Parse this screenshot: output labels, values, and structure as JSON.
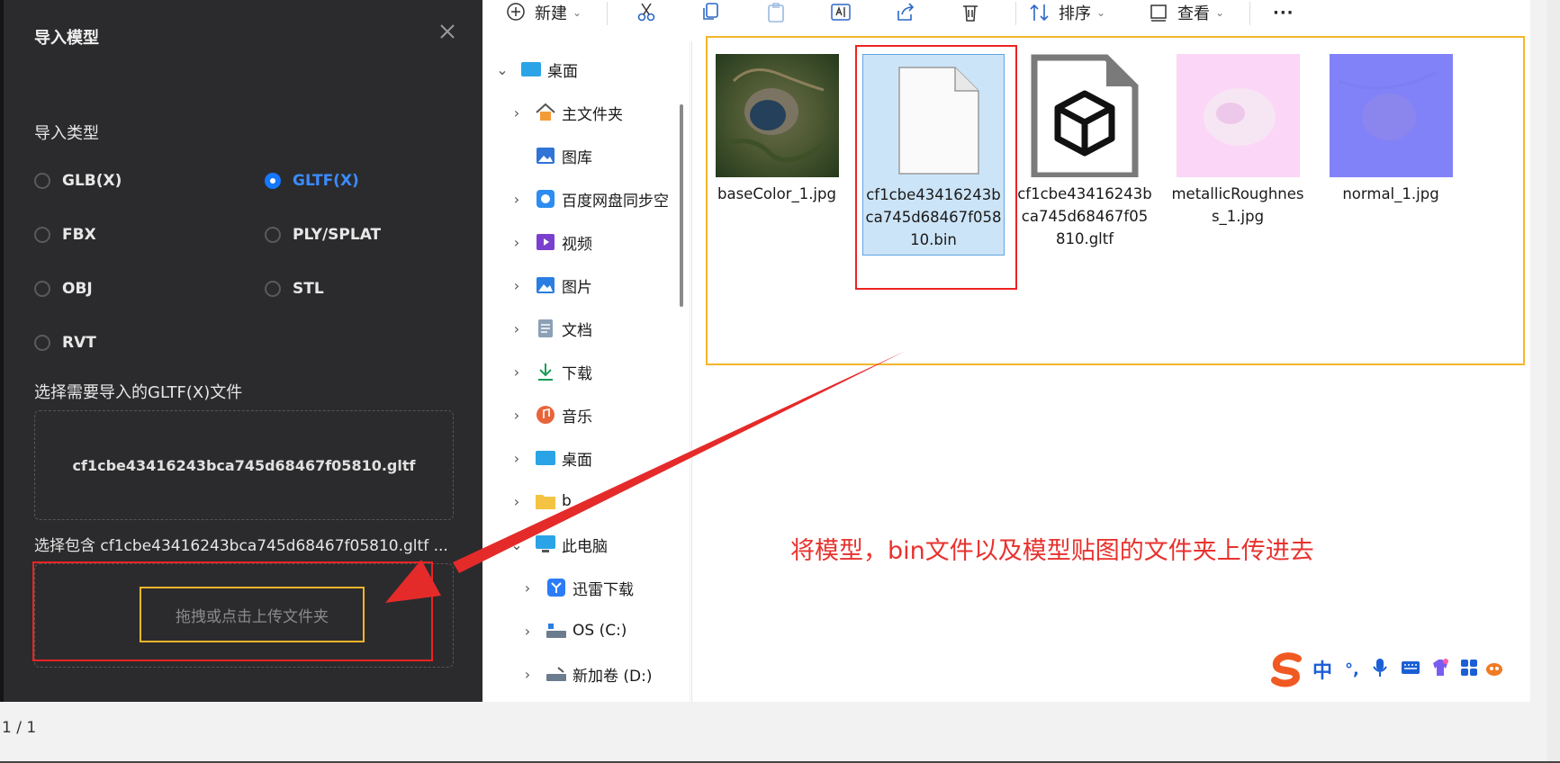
{
  "dialog": {
    "title": "导入模型",
    "import_type_label": "导入类型",
    "types": [
      {
        "label": "GLB(X)",
        "selected": false
      },
      {
        "label": "GLTF(X)",
        "selected": true
      },
      {
        "label": "FBX",
        "selected": false
      },
      {
        "label": "PLY/SPLAT",
        "selected": false
      },
      {
        "label": "OBJ",
        "selected": false
      },
      {
        "label": "STL",
        "selected": false
      },
      {
        "label": "RVT",
        "selected": false
      }
    ],
    "select_file_label": "选择需要导入的GLTF(X)文件",
    "selected_file": "cf1cbe43416243bca745d68467f05810.gltf",
    "select_folder_label": "选择包含 cf1cbe43416243bca745d68467f05810.gltf ...",
    "upload_hint": "拖拽或点击上传文件夹",
    "accent_color": "#1677ff"
  },
  "explorer": {
    "toolbar": {
      "new_label": "新建",
      "sort_label": "排序",
      "view_label": "查看",
      "more_label": "···"
    },
    "nav": [
      {
        "label": "桌面",
        "icon": "desktop-icon",
        "expanded": true
      },
      {
        "label": "主文件夹",
        "icon": "home-icon"
      },
      {
        "label": "图库",
        "icon": "gallery-icon"
      },
      {
        "label": "百度网盘同步空",
        "icon": "baidu-netdisk-icon"
      },
      {
        "label": "视频",
        "icon": "video-icon"
      },
      {
        "label": "图片",
        "icon": "pictures-icon"
      },
      {
        "label": "文档",
        "icon": "documents-icon"
      },
      {
        "label": "下载",
        "icon": "download-icon"
      },
      {
        "label": "音乐",
        "icon": "music-icon"
      },
      {
        "label": "桌面",
        "icon": "desktop-icon"
      },
      {
        "label": "b",
        "icon": "folder-icon"
      },
      {
        "label": "此电脑",
        "icon": "this-pc-icon",
        "expanded": true
      },
      {
        "label": "迅雷下载",
        "icon": "thunder-icon"
      },
      {
        "label": "OS (C:)",
        "icon": "drive-icon"
      },
      {
        "label": "新加卷 (D:)",
        "icon": "drive-icon"
      }
    ],
    "files": [
      {
        "name": "baseColor_1.jpg",
        "kind": "image-terrain"
      },
      {
        "name": "cf1cbe43416243bca745d68467f05810.bin",
        "kind": "blank-doc",
        "selected": true
      },
      {
        "name": "cf1cbe43416243bca745d68467f05810.gltf",
        "kind": "gltf-doc"
      },
      {
        "name": "metallicRoughness_1.jpg",
        "kind": "image-pink"
      },
      {
        "name": "normal_1.jpg",
        "kind": "image-normal"
      }
    ]
  },
  "annotation": "将模型，bin文件以及模型贴图的文件夹上传进去",
  "ime": {
    "lang": "中",
    "punct": "°,"
  },
  "pager": "1 / 1"
}
